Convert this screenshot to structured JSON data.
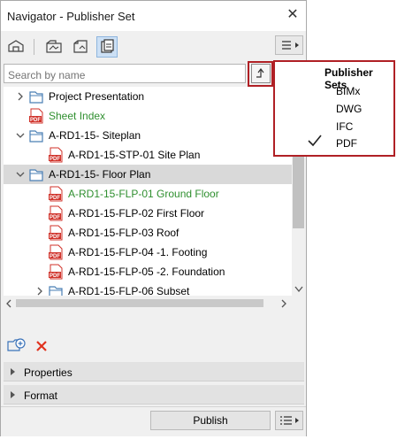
{
  "window": {
    "title": "Navigator - Publisher Set",
    "close_glyph": "✕"
  },
  "toolbar": {
    "icons": [
      "project-map-icon",
      "view-map-icon",
      "layout-book-icon",
      "publisher-sets-icon"
    ],
    "active_index": 3,
    "menu_icon": "hamburger-menu-icon"
  },
  "search": {
    "placeholder": "Search by name",
    "value": ""
  },
  "tree": {
    "rows": [
      {
        "label": "Project Presentation",
        "expander": "collapsed",
        "icon": "folder-icon",
        "green": false,
        "selected": false
      },
      {
        "label": "Sheet Index",
        "expander": "none",
        "icon": "pdf-icon",
        "green": true,
        "selected": false
      },
      {
        "label": "A-RD1-15- Siteplan",
        "expander": "expanded",
        "icon": "folder-icon",
        "green": false,
        "selected": false
      },
      {
        "label": "A-RD1-15-STP-01 Site Plan",
        "expander": "none",
        "icon": "pdf-icon",
        "green": false,
        "selected": false
      },
      {
        "label": "A-RD1-15- Floor Plan",
        "expander": "expanded",
        "icon": "folder-icon",
        "green": false,
        "selected": true
      },
      {
        "label": "A-RD1-15-FLP-01 Ground Floor",
        "expander": "none",
        "icon": "pdf-icon",
        "green": true,
        "selected": false
      },
      {
        "label": "A-RD1-15-FLP-02 First Floor",
        "expander": "none",
        "icon": "pdf-icon",
        "green": false,
        "selected": false
      },
      {
        "label": "A-RD1-15-FLP-03 Roof",
        "expander": "none",
        "icon": "pdf-icon",
        "green": false,
        "selected": false
      },
      {
        "label": "A-RD1-15-FLP-04 -1. Footing",
        "expander": "none",
        "icon": "pdf-icon",
        "green": false,
        "selected": false
      },
      {
        "label": "A-RD1-15-FLP-05 -2. Foundation",
        "expander": "none",
        "icon": "pdf-icon",
        "green": false,
        "selected": false
      },
      {
        "label": "A-RD1-15-FLP-06 Subset",
        "expander": "collapsed",
        "icon": "folder-icon",
        "green": false,
        "selected": false
      }
    ]
  },
  "sections": {
    "properties": "Properties",
    "format": "Format"
  },
  "footer": {
    "publish_label": "Publish"
  },
  "popup": {
    "title": "Publisher Sets",
    "options": [
      {
        "label": "BIMx",
        "checked": false
      },
      {
        "label": "DWG",
        "checked": false
      },
      {
        "label": "IFC",
        "checked": false
      },
      {
        "label": "PDF",
        "checked": true
      }
    ]
  },
  "colors": {
    "highlight_border": "#b02025",
    "green_text": "#2f8f2f",
    "pdf_red": "#d0322a",
    "folder_blue": "#4a7fb5",
    "delete_red": "#e0321e"
  }
}
